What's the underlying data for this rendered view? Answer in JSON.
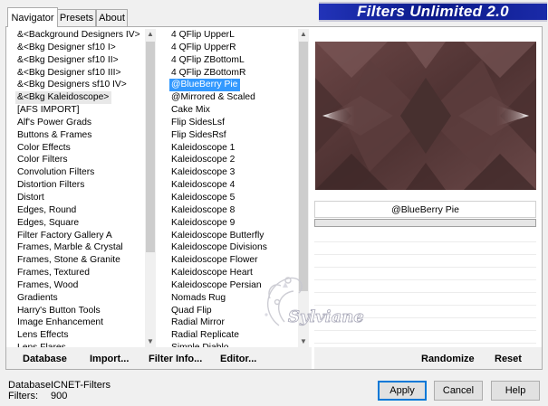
{
  "tabs": [
    "Navigator",
    "Presets",
    "About"
  ],
  "banner_title": "Filters Unlimited 2.0",
  "categories": [
    "&<Background Designers IV>",
    "&<Bkg Designer sf10 I>",
    "&<Bkg Designer sf10 II>",
    "&<Bkg Designer sf10 III>",
    "&<Bkg Designers sf10 IV>",
    "&<Bkg Kaleidoscope>",
    "[AFS IMPORT]",
    "Alf's Power Grads",
    "Buttons & Frames",
    "Color Effects",
    "Color Filters",
    "Convolution Filters",
    "Distortion Filters",
    "Distort",
    "Edges, Round",
    "Edges, Square",
    "Filter Factory Gallery A",
    "Frames, Marble & Crystal",
    "Frames, Stone & Granite",
    "Frames, Textured",
    "Frames, Wood",
    "Gradients",
    "Harry's Button Tools",
    "Image Enhancement",
    "Lens Effects",
    "Lens Flares"
  ],
  "categories_current_index": 5,
  "filters": [
    "4 QFlip UpperL",
    "4 QFlip UpperR",
    "4 QFlip ZBottomL",
    "4 QFlip ZBottomR",
    "@BlueBerry Pie",
    "@Mirrored & Scaled",
    "Cake Mix",
    "Flip SidesLsf",
    "Flip SidesRsf",
    "Kaleidoscope 1",
    "Kaleidoscope 2",
    "Kaleidoscope 3",
    "Kaleidoscope 4",
    "Kaleidoscope 5",
    "Kaleidoscope 8",
    "Kaleidoscope 9",
    "Kaleidoscope Butterfly",
    "Kaleidoscope Divisions",
    "Kaleidoscope Flower",
    "Kaleidoscope Heart",
    "Kaleidoscope Persian",
    "Nomads Rug",
    "Quad Flip",
    "Radial Mirror",
    "Radial Replicate",
    "Simple Diablo"
  ],
  "filters_selected_index": 4,
  "selected_filter_name": "@BlueBerry Pie",
  "watermark": "Sylviane",
  "toolbar": {
    "database": "Database",
    "import": "Import...",
    "filter_info": "Filter Info...",
    "editor": "Editor...",
    "randomize": "Randomize",
    "reset": "Reset"
  },
  "footer": {
    "database_label": "Database:",
    "database_value": "ICNET-Filters",
    "filters_label": "Filters:",
    "filters_value": "900"
  },
  "buttons": {
    "apply": "Apply",
    "cancel": "Cancel",
    "help": "Help"
  },
  "colors": {
    "selection": "#3399ff",
    "banner": "#0b1a8a",
    "preview_base": "#5a3a3a"
  }
}
